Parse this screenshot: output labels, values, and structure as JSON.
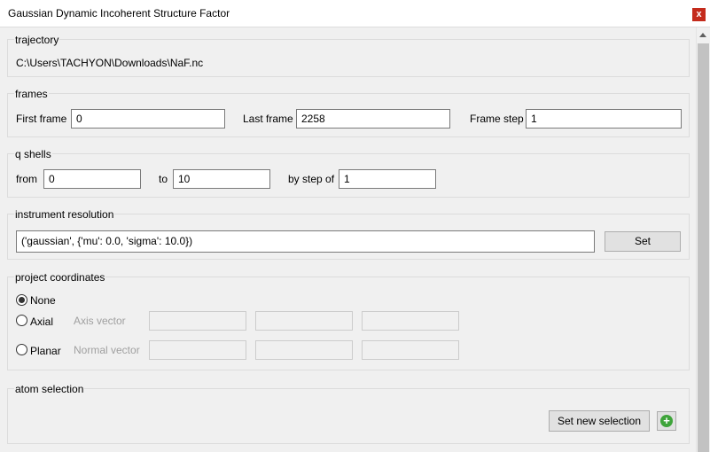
{
  "window": {
    "title": "Gaussian Dynamic Incoherent Structure Factor",
    "close_label": "x"
  },
  "trajectory": {
    "title": "trajectory",
    "path": "C:\\Users\\TACHYON\\Downloads\\NaF.nc"
  },
  "frames": {
    "title": "frames",
    "first_label": "First frame",
    "first_value": "0",
    "last_label": "Last frame",
    "last_value": "2258",
    "step_label": "Frame step",
    "step_value": "1"
  },
  "q_shells": {
    "title": "q shells",
    "from_label": "from",
    "from_value": "0",
    "to_label": "to",
    "to_value": "10",
    "step_label": "by step of",
    "step_value": "1"
  },
  "instrument_resolution": {
    "title": "instrument resolution",
    "value": "('gaussian', {'mu': 0.0, 'sigma': 10.0})",
    "set_label": "Set"
  },
  "project_coordinates": {
    "title": "project coordinates",
    "none_label": "None",
    "axial_label": "Axial",
    "axial_vector_label": "Axis vector",
    "planar_label": "Planar",
    "planar_vector_label": "Normal vector",
    "selected": "None"
  },
  "atom_selection": {
    "title": "atom selection",
    "set_new_label": "Set new selection",
    "add_icon": "plus-circle-icon"
  },
  "colors": {
    "close": "#c42b1c",
    "add_icon": "#3ea43a"
  }
}
